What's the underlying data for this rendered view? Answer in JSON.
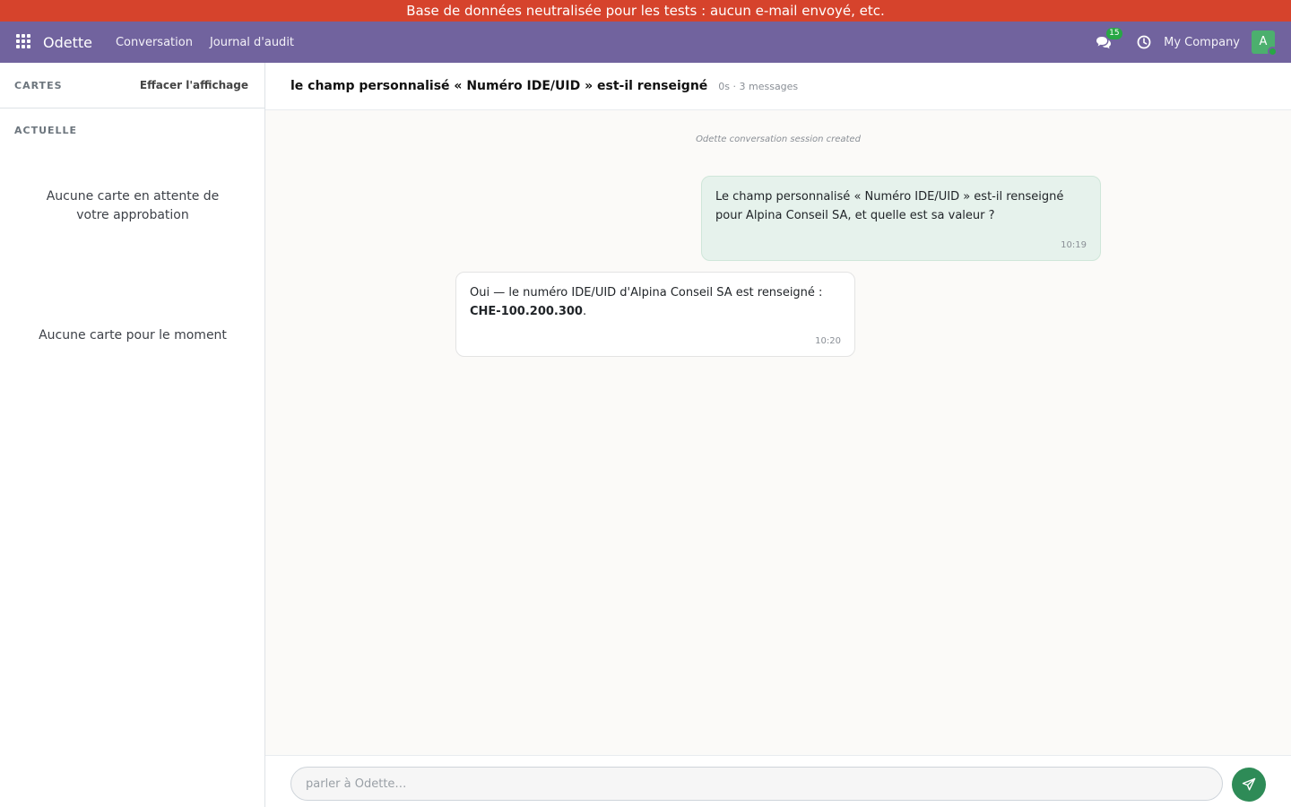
{
  "banner": {
    "text": "Base de données neutralisée pour les tests : aucun e-mail envoyé, etc."
  },
  "navbar": {
    "brand": "Odette",
    "links": [
      "Conversation",
      "Journal d'audit"
    ],
    "chat_badge": "15",
    "company": "My Company",
    "avatar_letter": "A"
  },
  "sidebar": {
    "title": "CARTES",
    "clear_label": "Effacer l'affichage",
    "section": "ACTUELLE",
    "empty_pending": "Aucune carte en attente de votre approbation",
    "empty_cards": "Aucune carte pour le moment"
  },
  "conversation": {
    "title": "le champ personnalisé « Numéro IDE/UID » est-il renseigné",
    "meta": "0s · 3 messages",
    "system_note": "Odette conversation session created",
    "messages": [
      {
        "role": "user",
        "text": "Le champ personnalisé « Numéro IDE/UID » est-il renseigné pour Alpina Conseil SA, et quelle est sa valeur ?",
        "time": "10:19"
      },
      {
        "role": "assistant",
        "text_before": "Oui — le numéro IDE/UID d'Alpina Conseil SA est renseigné : ",
        "text_bold": "CHE-100.200.300",
        "text_after": ".",
        "time": "10:20"
      }
    ]
  },
  "composer": {
    "placeholder": "parler à Odette…"
  },
  "colors": {
    "banner": "#d6432c",
    "navbar": "#71639e",
    "send": "#2e8b57",
    "user_bubble": "#e6f2ec",
    "badge": "#28a745"
  }
}
